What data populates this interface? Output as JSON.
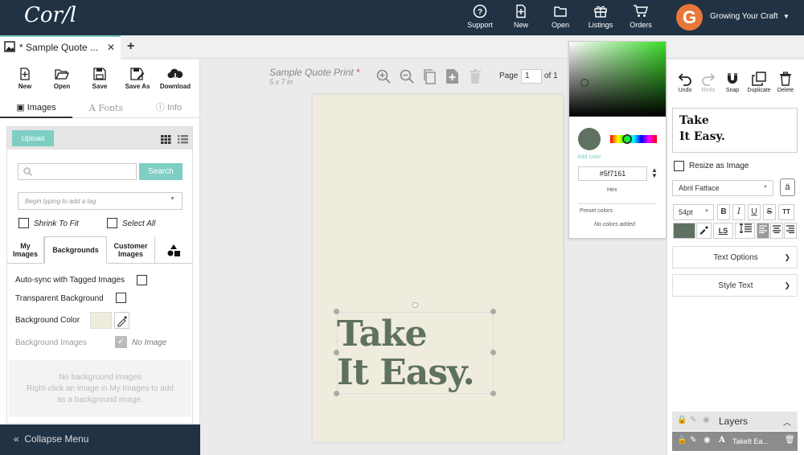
{
  "app": {
    "logo": "Cor/l"
  },
  "topnav": {
    "items": [
      {
        "label": "Support",
        "icon": "support-icon"
      },
      {
        "label": "New",
        "icon": "new-file-icon"
      },
      {
        "label": "Open",
        "icon": "folder-icon"
      },
      {
        "label": "Listings",
        "icon": "gift-icon"
      },
      {
        "label": "Orders",
        "icon": "cart-icon"
      }
    ],
    "avatar_letter": "G",
    "username": "Growing Your Craft"
  },
  "tabs": [
    {
      "label": "* Sample Quote ...",
      "close": "✕"
    }
  ],
  "new_tab": "+",
  "toolbar": [
    {
      "label": "New"
    },
    {
      "label": "Open"
    },
    {
      "label": "Save"
    },
    {
      "label": "Save As"
    },
    {
      "label": "Download"
    }
  ],
  "left_tabs": {
    "images": "Images",
    "fonts": "Fonts",
    "info": "Info"
  },
  "images_panel": {
    "upload": "Upload",
    "search_placeholder": "",
    "search_button": "Search",
    "tag_placeholder": "Begin typing to add a tag",
    "shrink_to_fit": "Shrink To Fit",
    "select_all": "Select All",
    "tabs": [
      "My Images",
      "Backgrounds",
      "Customer Images"
    ],
    "auto_sync": "Auto-sync with Tagged Images",
    "transparent_bg": "Transparent Background",
    "bg_color_label": "Background Color",
    "bg_images_label": "Background Images",
    "no_image": "No Image",
    "empty_line1": "No background images",
    "empty_line2": "Right-click an image in My Images to add",
    "empty_line3": "as a background image."
  },
  "collapse_menu": "Collapse Menu",
  "canvas": {
    "title": "Sample Quote Print",
    "title_star": "*",
    "size": "5 x 7 in",
    "page_label": "Page",
    "page_value": "1",
    "page_total": "of 1",
    "text_line1": "Take",
    "text_line2": "It Easy.",
    "page_color": "#efecdd",
    "text_color": "#5f7161"
  },
  "color_picker": {
    "add_color": "Add color",
    "hex_value": "#5f7161",
    "hex_label": "Hex",
    "preset_label": "Preset colors",
    "no_colors": "No colors added"
  },
  "right_panel": {
    "tools": [
      "Undo",
      "Redo",
      "Snap",
      "Duplicate",
      "Delete"
    ],
    "preview_line1": "Take",
    "preview_line2": "It Easy.",
    "resize_as_image": "Resize as Image",
    "font": "Abril Fatface",
    "glyph": "ä",
    "font_size": "54pt",
    "format": [
      "B",
      "I",
      "U",
      "S",
      "TT"
    ],
    "ls": "LS",
    "text_options": "Text Options",
    "style_text": "Style Text",
    "layers_title": "Layers",
    "layer_name": "TakeIt Ea..."
  }
}
